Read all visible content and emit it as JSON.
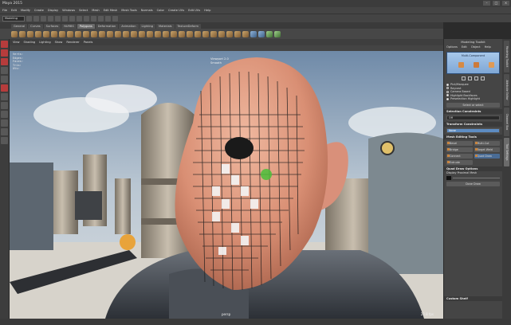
{
  "window": {
    "title": "Maya 2015",
    "buttons": [
      "–",
      "□",
      "×"
    ]
  },
  "menubar": [
    "File",
    "Edit",
    "Modify",
    "Create",
    "Display",
    "Windows",
    "Select",
    "Mesh",
    "Edit Mesh",
    "Mesh Tools",
    "Normals",
    "Color",
    "Create UVs",
    "Edit UVs",
    "Help"
  ],
  "status": {
    "mode": "Modeling"
  },
  "shelf_tabs": [
    {
      "label": "General",
      "active": false
    },
    {
      "label": "Curves",
      "active": false
    },
    {
      "label": "Surfaces",
      "active": false
    },
    {
      "label": "NURBS",
      "active": false
    },
    {
      "label": "Polygons",
      "active": true
    },
    {
      "label": "Deformation",
      "active": false
    },
    {
      "label": "Animation",
      "active": false
    },
    {
      "label": "Lighting",
      "active": false
    },
    {
      "label": "Materials",
      "active": false
    },
    {
      "label": "TextureDeform",
      "active": false
    }
  ],
  "panel_menu": [
    "View",
    "Shading",
    "Lighting",
    "Show",
    "Renderer",
    "Panels"
  ],
  "hud": {
    "rows": [
      [
        "Verts:",
        "",
        "",
        ""
      ],
      [
        "Edges:",
        "",
        "",
        ""
      ],
      [
        "Faces:",
        "",
        "",
        ""
      ],
      [
        "Tris:",
        "",
        "",
        ""
      ],
      [
        "UVs:",
        "",
        "",
        ""
      ]
    ],
    "view_lines": [
      "Viewport 2.0",
      "Smooth"
    ]
  },
  "viewport": {
    "camera": "persp",
    "fps": "22.8 fps"
  },
  "modeling_toolkit": {
    "title": "Modeling Toolkit",
    "menu": [
      "Options",
      "Edit",
      "Object",
      "Help"
    ],
    "header": "Multi-Component",
    "radios": [
      {
        "label": "Pick/Marquee",
        "on": true
      },
      {
        "label": "Raycast",
        "on": false
      },
      {
        "label": "Camera Based",
        "on": false
      },
      {
        "label": "Highlight Backfaces",
        "on": true
      },
      {
        "label": "Preselection Highlight",
        "on": true
      }
    ],
    "clear_btn": "Select or select",
    "selection_constraints": "Selection Constraints",
    "sc_field": "Off",
    "transform_constraints": "Transform Constraints",
    "tc_field": "None",
    "mesh_editing": "Mesh Editing Tools",
    "tools": [
      {
        "label": "Bevel",
        "sel": false
      },
      {
        "label": "Multi-Cut",
        "sel": false
      },
      {
        "label": "Bridge",
        "sel": false
      },
      {
        "label": "Target Weld",
        "sel": false
      },
      {
        "label": "Connect",
        "sel": false
      },
      {
        "label": "Quad Draw",
        "sel": true
      },
      {
        "label": "Extrude",
        "sel": false
      }
    ],
    "quad_draw_options": "Quad Draw Options",
    "qd_check": "Display Proximal Mesh",
    "qd_btn": "Done Draw",
    "custom_shelf": "Custom Shelf"
  },
  "side_tabs": [
    "Modeling Toolkit",
    "Attribute Editor",
    "Channel Box",
    "Tool Settings"
  ]
}
